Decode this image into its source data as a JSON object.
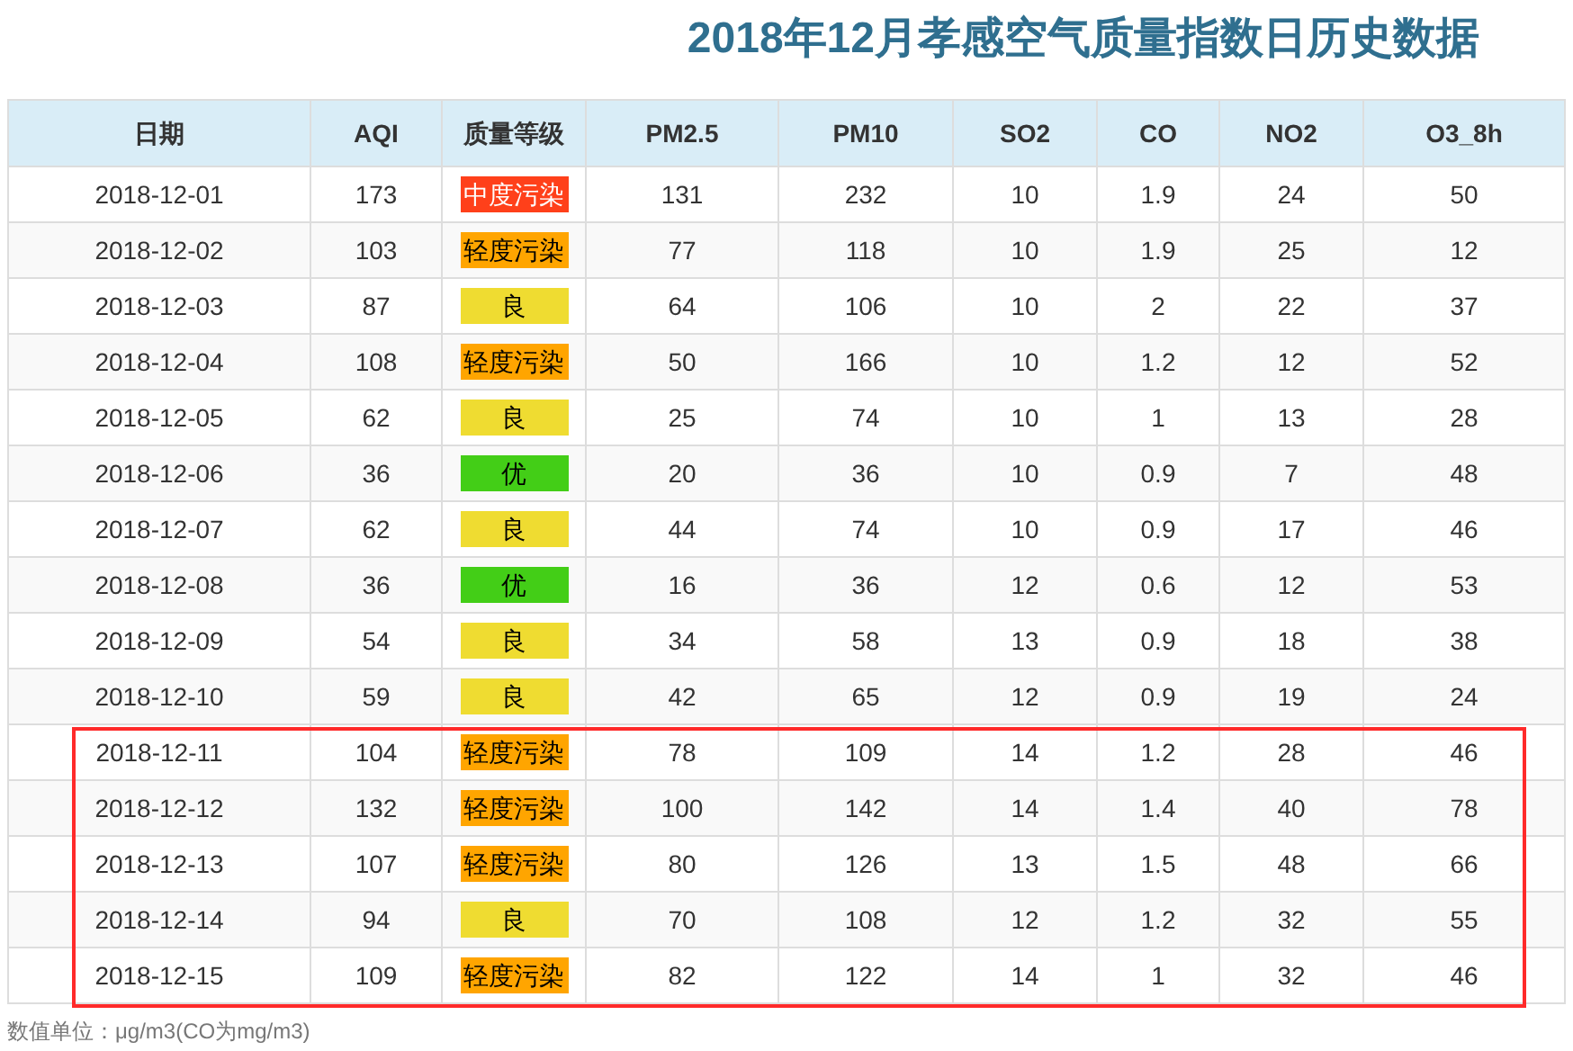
{
  "title": "2018年12月孝感空气质量指数日历史数据",
  "columns": [
    "日期",
    "AQI",
    "质量等级",
    "PM2.5",
    "PM10",
    "SO2",
    "CO",
    "NO2",
    "O3_8h"
  ],
  "rows": [
    {
      "date": "2018-12-01",
      "aqi": "173",
      "grade": {
        "label": "中度污染",
        "color": "#ff401a"
      },
      "values": [
        "131",
        "232",
        "10",
        "1.9",
        "24",
        "50"
      ],
      "highlighted": false
    },
    {
      "date": "2018-12-02",
      "aqi": "103",
      "grade": {
        "label": "轻度污染",
        "color": "#ffa500"
      },
      "values": [
        "77",
        "118",
        "10",
        "1.9",
        "25",
        "12"
      ],
      "highlighted": false
    },
    {
      "date": "2018-12-03",
      "aqi": "87",
      "grade": {
        "label": "良",
        "color": "#efdc31"
      },
      "values": [
        "64",
        "106",
        "10",
        "2",
        "22",
        "37"
      ],
      "highlighted": false
    },
    {
      "date": "2018-12-04",
      "aqi": "108",
      "grade": {
        "label": "轻度污染",
        "color": "#ffa500"
      },
      "values": [
        "50",
        "166",
        "10",
        "1.2",
        "12",
        "52"
      ],
      "highlighted": false
    },
    {
      "date": "2018-12-05",
      "aqi": "62",
      "grade": {
        "label": "良",
        "color": "#efdc31"
      },
      "values": [
        "25",
        "74",
        "10",
        "1",
        "13",
        "28"
      ],
      "highlighted": false
    },
    {
      "date": "2018-12-06",
      "aqi": "36",
      "grade": {
        "label": "优",
        "color": "#43ce17"
      },
      "values": [
        "20",
        "36",
        "10",
        "0.9",
        "7",
        "48"
      ],
      "highlighted": false
    },
    {
      "date": "2018-12-07",
      "aqi": "62",
      "grade": {
        "label": "良",
        "color": "#efdc31"
      },
      "values": [
        "44",
        "74",
        "10",
        "0.9",
        "17",
        "46"
      ],
      "highlighted": false
    },
    {
      "date": "2018-12-08",
      "aqi": "36",
      "grade": {
        "label": "优",
        "color": "#43ce17"
      },
      "values": [
        "16",
        "36",
        "12",
        "0.6",
        "12",
        "53"
      ],
      "highlighted": false
    },
    {
      "date": "2018-12-09",
      "aqi": "54",
      "grade": {
        "label": "良",
        "color": "#efdc31"
      },
      "values": [
        "34",
        "58",
        "13",
        "0.9",
        "18",
        "38"
      ],
      "highlighted": false
    },
    {
      "date": "2018-12-10",
      "aqi": "59",
      "grade": {
        "label": "良",
        "color": "#efdc31"
      },
      "values": [
        "42",
        "65",
        "12",
        "0.9",
        "19",
        "24"
      ],
      "highlighted": false
    },
    {
      "date": "2018-12-11",
      "aqi": "104",
      "grade": {
        "label": "轻度污染",
        "color": "#ffa500"
      },
      "values": [
        "78",
        "109",
        "14",
        "1.2",
        "28",
        "46"
      ],
      "highlighted": true
    },
    {
      "date": "2018-12-12",
      "aqi": "132",
      "grade": {
        "label": "轻度污染",
        "color": "#ffa500"
      },
      "values": [
        "100",
        "142",
        "14",
        "1.4",
        "40",
        "78"
      ],
      "highlighted": true
    },
    {
      "date": "2018-12-13",
      "aqi": "107",
      "grade": {
        "label": "轻度污染",
        "color": "#ffa500"
      },
      "values": [
        "80",
        "126",
        "13",
        "1.5",
        "48",
        "66"
      ],
      "highlighted": true
    },
    {
      "date": "2018-12-14",
      "aqi": "94",
      "grade": {
        "label": "良",
        "color": "#efdc31"
      },
      "values": [
        "70",
        "108",
        "12",
        "1.2",
        "32",
        "55"
      ],
      "highlighted": true
    },
    {
      "date": "2018-12-15",
      "aqi": "109",
      "grade": {
        "label": "轻度污染",
        "color": "#ffa500"
      },
      "values": [
        "82",
        "122",
        "14",
        "1",
        "32",
        "46"
      ],
      "highlighted": true
    }
  ],
  "footnote": "数值单位：μg/m3(CO为mg/m3)"
}
